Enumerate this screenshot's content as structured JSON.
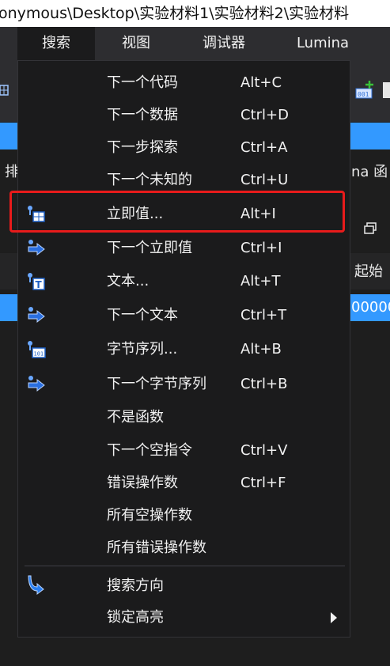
{
  "title": "onymous\\Desktop\\实验材料1\\实验材料2\\实验材料",
  "menubar": {
    "items": [
      {
        "label": "搜索"
      },
      {
        "label": "视图"
      },
      {
        "label": "调试器"
      },
      {
        "label": "Lumina"
      }
    ]
  },
  "background": {
    "left_snippet": "排",
    "right_snippet": "na 函",
    "column_header": "起始",
    "cell_value": "00000"
  },
  "dropdown": {
    "items": [
      {
        "label": "下一个代码",
        "shortcut": "Alt+C"
      },
      {
        "label": "下一个数据",
        "shortcut": "Ctrl+D"
      },
      {
        "label": "下一步探索",
        "shortcut": "Ctrl+A"
      },
      {
        "label": "下一个未知的",
        "shortcut": "Ctrl+U"
      },
      {
        "label": "立即值...",
        "shortcut": "Alt+I",
        "icon": "immediate-value-icon"
      },
      {
        "label": "下一个立即值",
        "shortcut": "Ctrl+I",
        "icon": "next-arrow-icon"
      },
      {
        "label": "文本...",
        "shortcut": "Alt+T",
        "icon": "text-search-icon"
      },
      {
        "label": "下一个文本",
        "shortcut": "Ctrl+T",
        "icon": "next-arrow-icon"
      },
      {
        "label": "字节序列...",
        "shortcut": "Alt+B",
        "icon": "byte-sequence-icon"
      },
      {
        "label": "下一个字节序列",
        "shortcut": "Ctrl+B",
        "icon": "next-arrow-icon"
      },
      {
        "label": "不是函数",
        "shortcut": ""
      },
      {
        "label": "下一个空指令",
        "shortcut": "Ctrl+V"
      },
      {
        "label": "错误操作数",
        "shortcut": "Ctrl+F"
      },
      {
        "label": "所有空操作数",
        "shortcut": ""
      },
      {
        "label": "所有错误操作数",
        "shortcut": ""
      },
      {
        "label": "搜索方向",
        "shortcut": "",
        "icon": "search-direction-icon"
      },
      {
        "label": "锁定高亮",
        "shortcut": "",
        "submenu": true
      }
    ]
  },
  "colors": {
    "menu_bg": "#1b1b1c",
    "menubar_bg": "#2d2d30",
    "accent_blue": "#3399ff",
    "highlight_red": "#e81b1b"
  }
}
